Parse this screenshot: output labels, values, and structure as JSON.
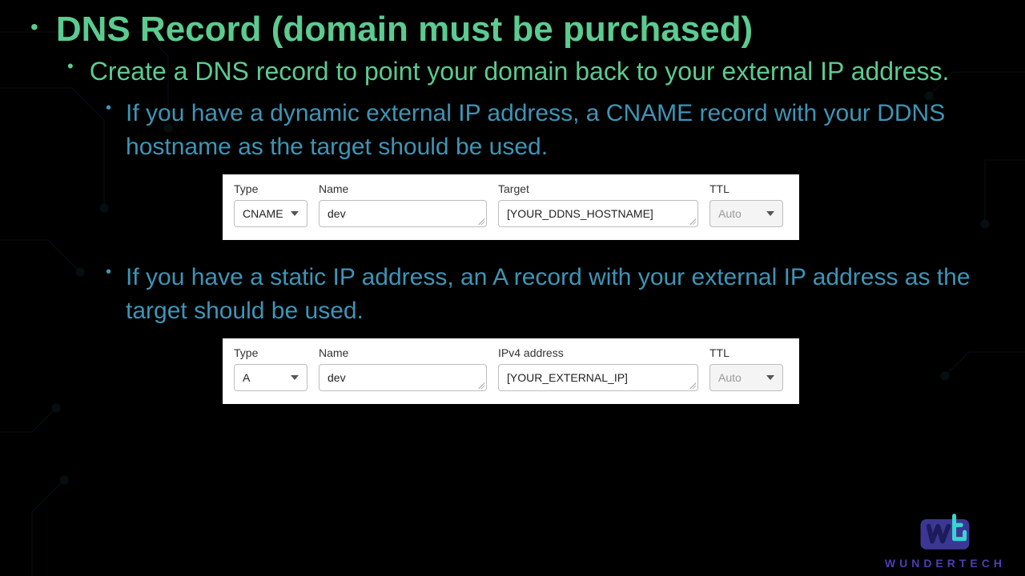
{
  "title": "DNS Record (domain must be purchased)",
  "sub1": "Create a DNS record to point your domain back to your external IP address.",
  "dynamic_text": "If you have a dynamic external IP address, a CNAME record with your DDNS hostname as the target should be used.",
  "static_text": "If you have a static IP address, an A record with your external IP address as the target should be used.",
  "cname": {
    "type_label": "Type",
    "type_value": "CNAME",
    "name_label": "Name",
    "name_value": "dev",
    "target_label": "Target",
    "target_value": "[YOUR_DDNS_HOSTNAME]",
    "ttl_label": "TTL",
    "ttl_value": "Auto"
  },
  "arecord": {
    "type_label": "Type",
    "type_value": "A",
    "name_label": "Name",
    "name_value": "dev",
    "target_label": "IPv4 address",
    "target_value": "[YOUR_EXTERNAL_IP]",
    "ttl_label": "TTL",
    "ttl_value": "Auto"
  },
  "brand": "WUNDERTECH"
}
